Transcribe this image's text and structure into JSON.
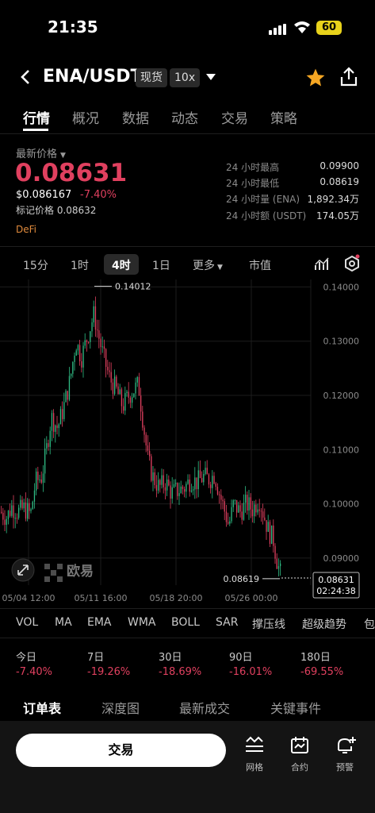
{
  "status": {
    "time": "21:35",
    "battery": "60"
  },
  "header": {
    "pair": "ENA/USDT",
    "spot_tag": "现货",
    "leverage_tag": "10x"
  },
  "tabs": [
    "行情",
    "概况",
    "数据",
    "动态",
    "交易",
    "策略"
  ],
  "price_block": {
    "latest_label": "最新价格",
    "price": "0.08631",
    "usd_price": "$0.086167",
    "change": "-7.40%",
    "mark_price": "标记价格 0.08632",
    "category": "DeFi"
  },
  "stats": [
    {
      "label": "24 小时最高",
      "value": "0.09900"
    },
    {
      "label": "24 小时最低",
      "value": "0.08619"
    },
    {
      "label": "24 小时量 (ENA)",
      "value": "1,892.34万"
    },
    {
      "label": "24 小时额 (USDT)",
      "value": "174.05万"
    }
  ],
  "intervals": {
    "i15": "15分",
    "i1h": "1时",
    "i4h": "4时",
    "i1d": "1日",
    "more": "更多",
    "mktcap": "市值"
  },
  "chart_data": {
    "type": "candlestick",
    "y_ticks": [
      "0.14000",
      "0.13000",
      "0.12000",
      "0.11000",
      "0.10000",
      "0.09000"
    ],
    "x_ticks": [
      "05/04 12:00",
      "05/11 16:00",
      "05/18 20:00",
      "05/26 00:00"
    ],
    "high_label": "0.14012",
    "low_label": "0.08619",
    "current_price": "0.08631",
    "countdown": "02:24:38",
    "ylim": [
      0.085,
      0.1405
    ],
    "watermark": "欧易",
    "up_color": "#2fbd85",
    "down_color": "#e0405f",
    "anchors": [
      [
        0,
        0.0985
      ],
      [
        8,
        0.0975
      ],
      [
        14,
        0.0995
      ],
      [
        22,
        0.0985
      ],
      [
        30,
        0.0992
      ],
      [
        38,
        0.098
      ],
      [
        44,
        0.104
      ],
      [
        52,
        0.105
      ],
      [
        58,
        0.11
      ],
      [
        64,
        0.116
      ],
      [
        72,
        0.114
      ],
      [
        80,
        0.118
      ],
      [
        88,
        0.123
      ],
      [
        95,
        0.13
      ],
      [
        102,
        0.127
      ],
      [
        110,
        0.131
      ],
      [
        118,
        0.135
      ],
      [
        122,
        0.132
      ],
      [
        130,
        0.127
      ],
      [
        138,
        0.123
      ],
      [
        146,
        0.121
      ],
      [
        154,
        0.118
      ],
      [
        162,
        0.12
      ],
      [
        168,
        0.121
      ],
      [
        174,
        0.122
      ],
      [
        180,
        0.115
      ],
      [
        186,
        0.108
      ],
      [
        192,
        0.105
      ],
      [
        200,
        0.103
      ],
      [
        208,
        0.104
      ],
      [
        216,
        0.102
      ],
      [
        224,
        0.1025
      ],
      [
        232,
        0.103
      ],
      [
        240,
        0.1045
      ],
      [
        248,
        0.104
      ],
      [
        256,
        0.105
      ],
      [
        264,
        0.1045
      ],
      [
        270,
        0.1055
      ],
      [
        276,
        0.102
      ],
      [
        282,
        0.099
      ],
      [
        288,
        0.096
      ],
      [
        294,
        0.1
      ],
      [
        302,
        0.0985
      ],
      [
        310,
        0.1
      ],
      [
        318,
        0.099
      ],
      [
        326,
        0.101
      ],
      [
        332,
        0.098
      ],
      [
        338,
        0.095
      ],
      [
        344,
        0.0935
      ],
      [
        348,
        0.09
      ],
      [
        352,
        0.0875
      ],
      [
        356,
        0.0863
      ]
    ]
  },
  "indicators": [
    "VOL",
    "MA",
    "EMA",
    "WMA",
    "BOLL",
    "SAR",
    "撑压线",
    "超级趋势",
    "包"
  ],
  "performance": [
    {
      "label": "今日",
      "value": "-7.40%"
    },
    {
      "label": "7日",
      "value": "-19.26%"
    },
    {
      "label": "30日",
      "value": "-18.69%"
    },
    {
      "label": "90日",
      "value": "-16.01%"
    },
    {
      "label": "180日",
      "value": "-69.55%"
    }
  ],
  "order_tabs": [
    "订单表",
    "深度图",
    "最新成交",
    "关键事件"
  ],
  "bottom": {
    "trade": "交易",
    "grid": "网格",
    "contract": "合约",
    "alert": "预警"
  }
}
